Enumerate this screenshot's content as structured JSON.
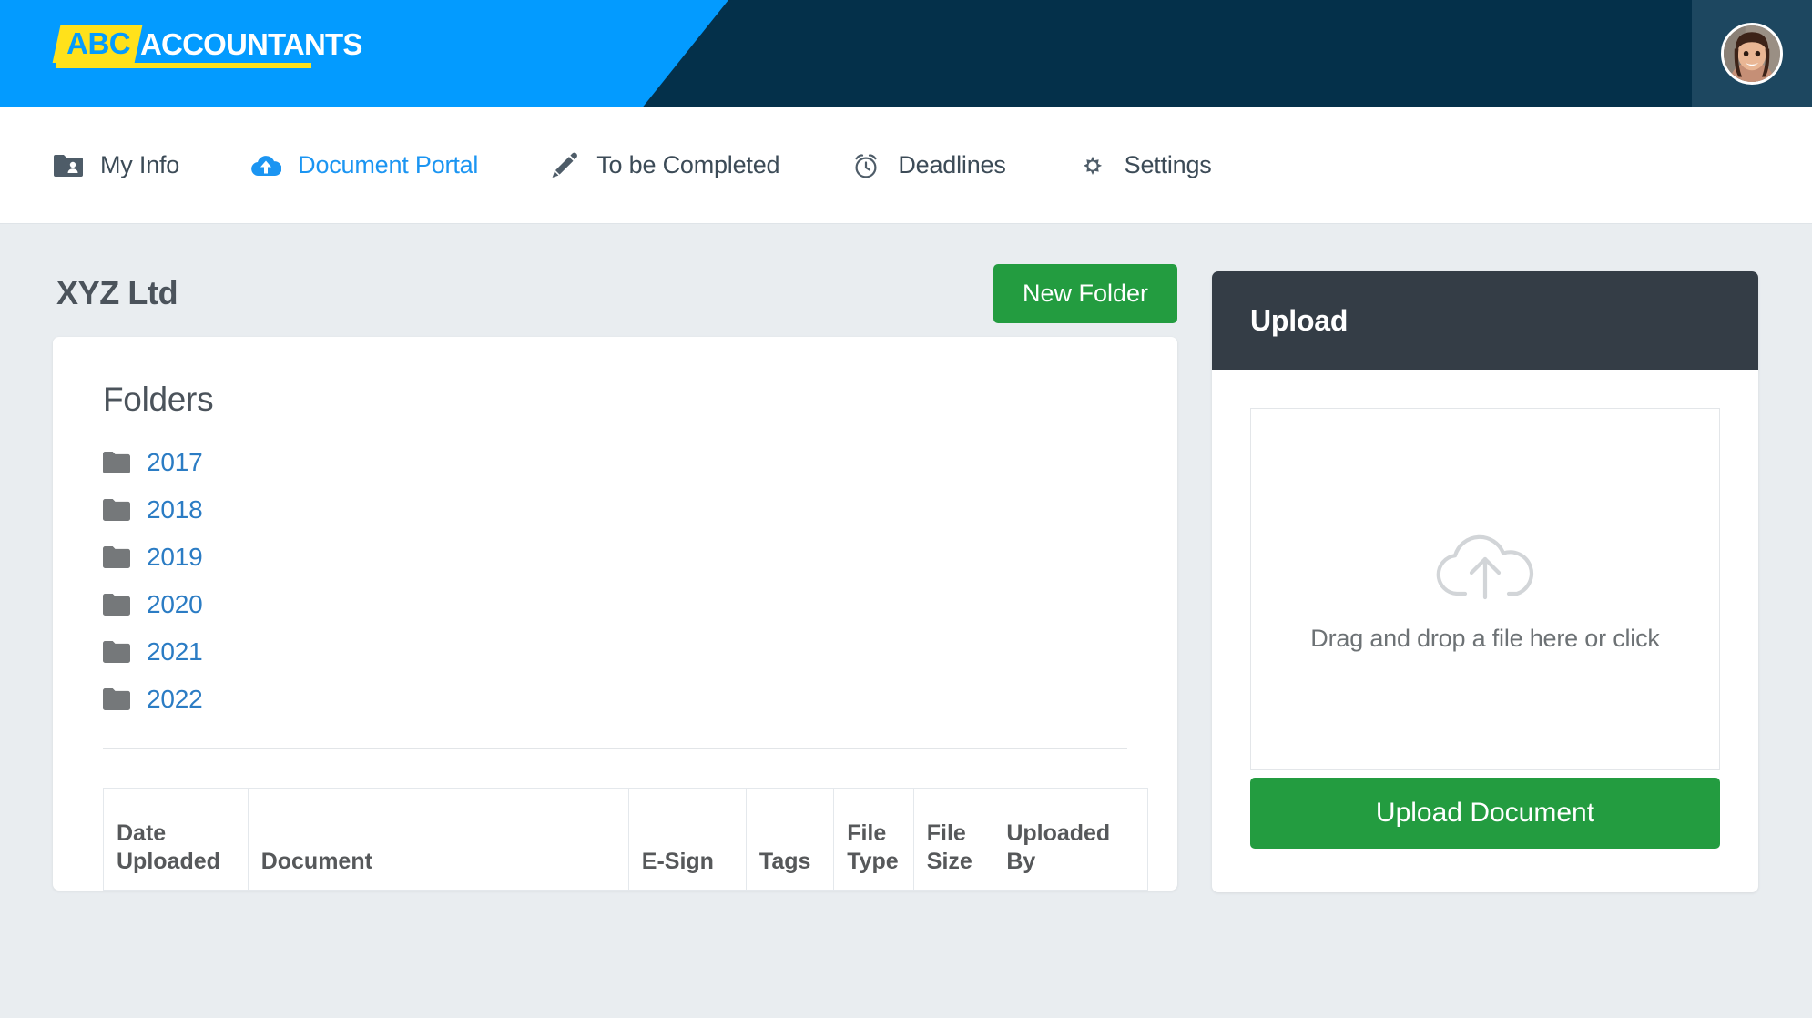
{
  "brand": {
    "logo_prefix": "ABC",
    "logo_suffix": "ACCOUNTANTS",
    "blue": "#039bff",
    "navy": "#04304a",
    "yellow": "#ffe11b"
  },
  "header": {
    "avatar_name": "user-avatar"
  },
  "nav": {
    "items": [
      {
        "label": "My Info",
        "icon": "folder-user-icon",
        "active": false
      },
      {
        "label": "Document Portal",
        "icon": "cloud-upload-icon",
        "active": true
      },
      {
        "label": "To be Completed",
        "icon": "pencil-icon",
        "active": false
      },
      {
        "label": "Deadlines",
        "icon": "alarm-clock-icon",
        "active": false
      },
      {
        "label": "Settings",
        "icon": "gear-icon",
        "active": false
      }
    ]
  },
  "main": {
    "page_title": "XYZ Ltd",
    "new_folder_label": "New Folder",
    "folders_heading": "Folders",
    "folders": [
      {
        "name": "2017"
      },
      {
        "name": "2018"
      },
      {
        "name": "2019"
      },
      {
        "name": "2020"
      },
      {
        "name": "2021"
      },
      {
        "name": "2022"
      }
    ],
    "table": {
      "columns": [
        "Date Uploaded",
        "Document",
        "E-Sign",
        "Tags",
        "File Type",
        "File Size",
        "Uploaded By"
      ],
      "rows": []
    }
  },
  "upload": {
    "title": "Upload",
    "dropzone_text": "Drag and drop a file here or click",
    "dropzone_icon": "cloud-upload-outline-icon",
    "button_label": "Upload Document"
  },
  "colors": {
    "green": "#239c40",
    "link_blue": "#2b7cc4",
    "active_blue": "#1b95f2",
    "page_bg": "#e9edf0",
    "panel_dark": "#343d46"
  }
}
